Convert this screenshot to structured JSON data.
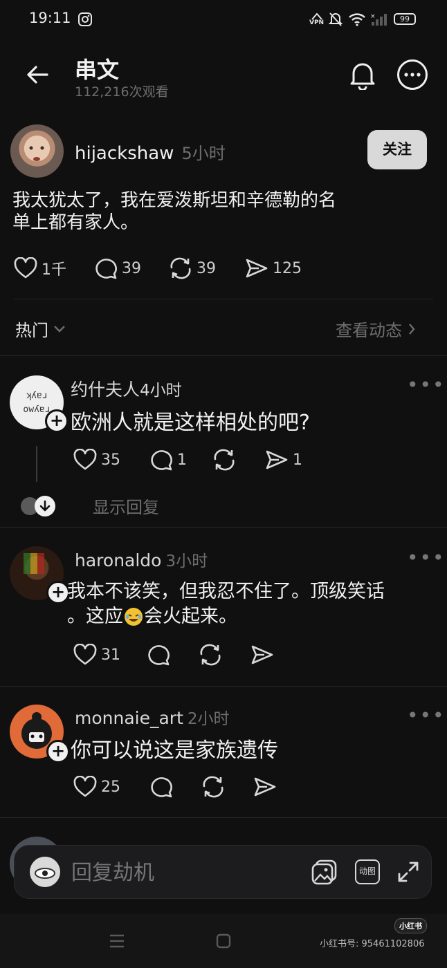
{
  "status_bar": {
    "time": "19:11",
    "vpn": "VPN",
    "battery": "99"
  },
  "header": {
    "title": "串文",
    "views": "112,216次观看"
  },
  "post": {
    "username": "hijackshaw",
    "time": "5小时",
    "follow_label": "关注",
    "text_line1": "我太犹太了，我在爱泼斯坦和辛德勒的名",
    "text_line2": "单上都有家人。",
    "likes": "1千",
    "comments": "39",
    "reposts": "39",
    "shares": "125"
  },
  "sort_bar": {
    "sort_label": "热门",
    "activity_label": "查看动态"
  },
  "replies": [
    {
      "username": "约什夫人",
      "time": "4小时",
      "text": "欧洲人就是这样相处的吧?",
      "avatar_text_1": "ʞʎɐɹ",
      "avatar_text_2": "owʎɐɹ",
      "likes": "35",
      "comments": "1",
      "shares": "1",
      "show_replies": "显示回复"
    },
    {
      "username": "haronaldo",
      "time": "3小时",
      "text_line1": "我本不该笑，但我忍不住了。顶级笑话",
      "text_line2a": "。这应",
      "text_line2b": "会火起来。",
      "likes": "31"
    },
    {
      "username": "monnaie_art",
      "time": "2小时",
      "text": "你可以说这是家族遗传",
      "likes": "25"
    }
  ],
  "reply_box": {
    "placeholder": "回复劫机",
    "gif_label": "动图"
  },
  "watermark": {
    "brand": "小红书",
    "id": "小红书号: 95461102806"
  },
  "colors": {
    "background": "#101010",
    "text": "#f0f0f0",
    "muted": "#6e6e6e",
    "button": "#d9d9d9"
  }
}
